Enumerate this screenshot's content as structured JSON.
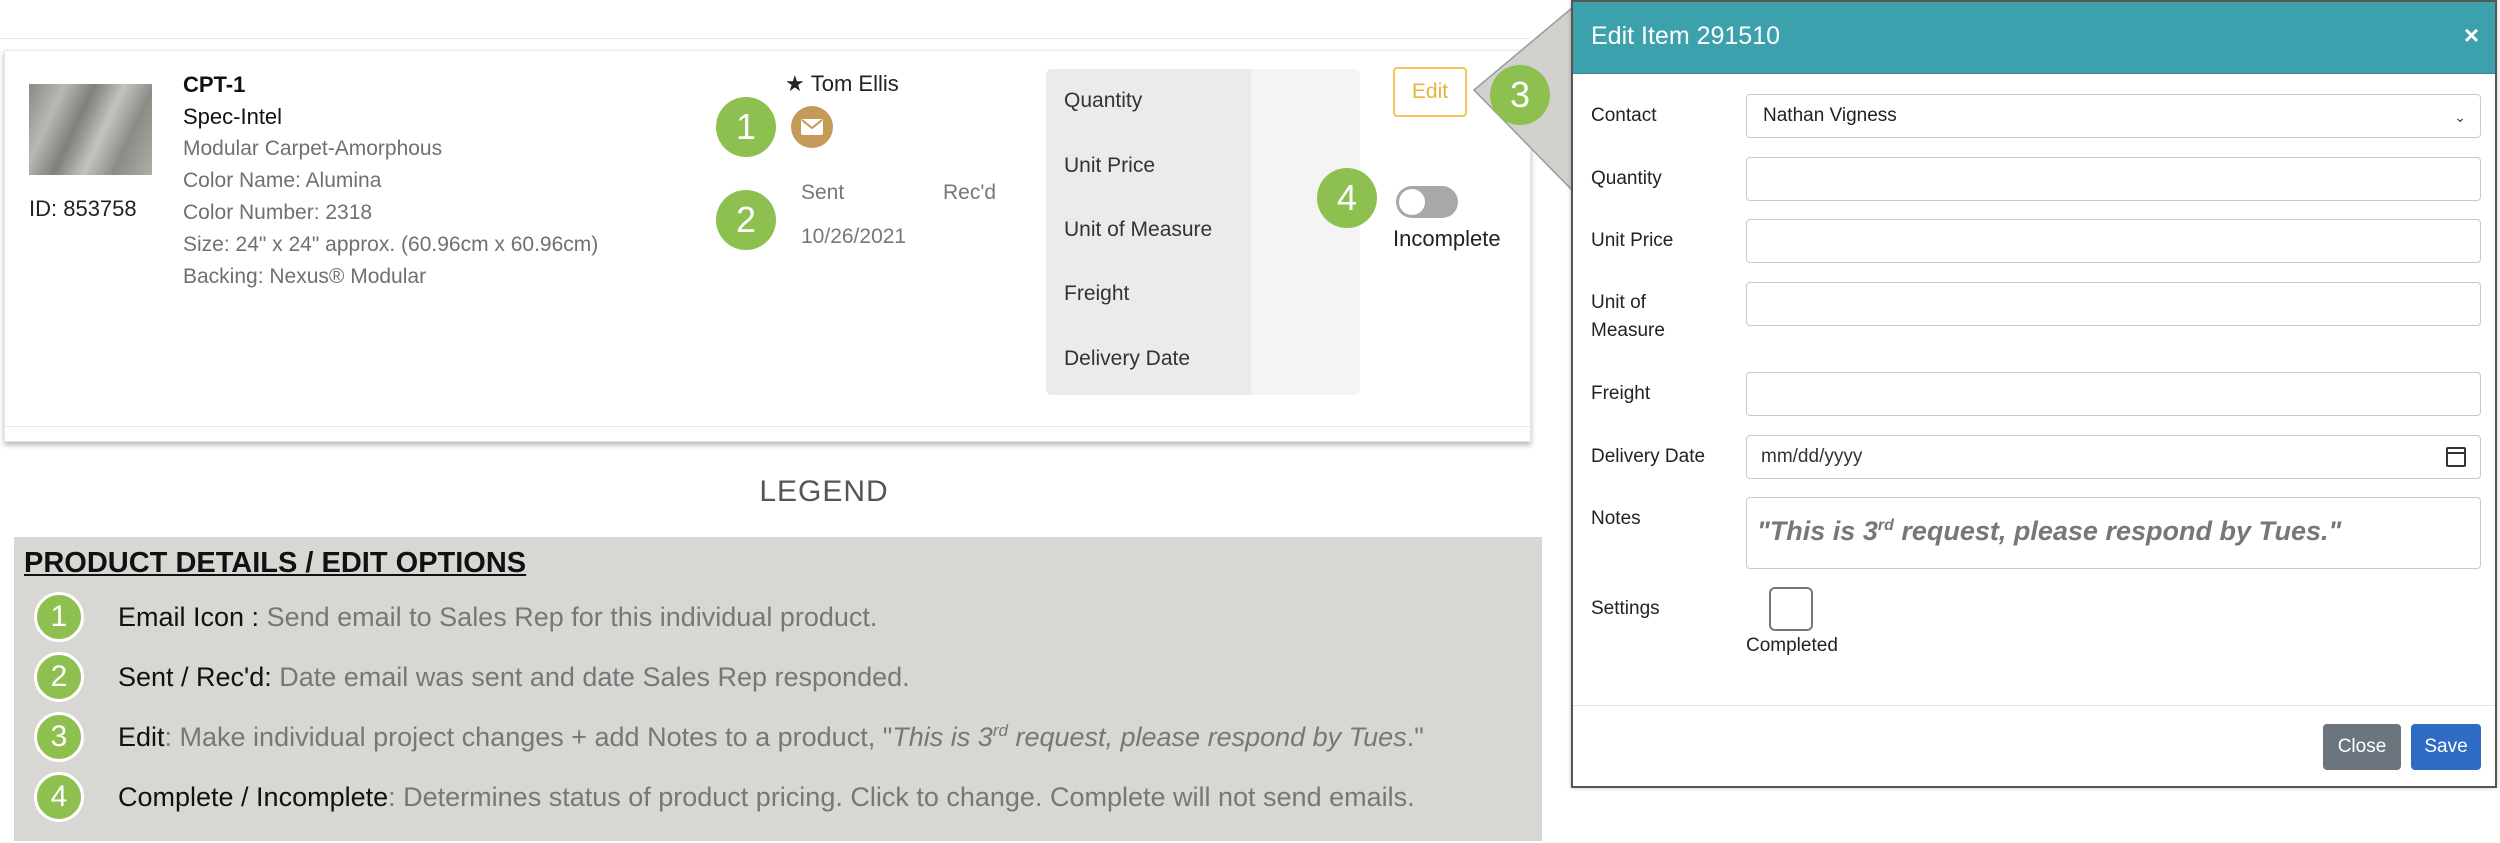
{
  "product": {
    "id_text": "ID: 853758",
    "code": "CPT-1",
    "spec": "Spec-Intel",
    "lines": [
      "Modular Carpet-Amorphous",
      "Color Name: Alumina",
      "Color Number: 2318",
      "Size: 24\" x 24\" approx. (60.96cm x 60.96cm)",
      "Backing: Nexus® Modular"
    ]
  },
  "sales_rep": {
    "star": "★",
    "name": "Tom Ellis",
    "mail_icon": "envelope-icon"
  },
  "status_dates": {
    "sent_label": "Sent",
    "recd_label": "Rec'd",
    "sent_date": "10/26/2021"
  },
  "pricing_labels": [
    "Quantity",
    "Unit Price",
    "Unit of Measure",
    "Freight",
    "Delivery Date"
  ],
  "edit_label": "Edit",
  "completion": {
    "label": "Incomplete",
    "is_complete": false
  },
  "badges": [
    "1",
    "2",
    "3",
    "4"
  ],
  "legend": {
    "title": "LEGEND",
    "heading": "PRODUCT DETAILS / EDIT OPTIONS",
    "rows": [
      {
        "num": "1",
        "term": "Email Icon :",
        "desc": " Send email to Sales Rep for this individual product."
      },
      {
        "num": "2",
        "term": "Sent / Rec'd:",
        "desc": " Date email was sent and date Sales Rep responded."
      },
      {
        "num": "3",
        "term": "Edit",
        "desc": ": Make individual project changes + add Notes to a product, \"",
        "quote_a": "This is 3",
        "sup": "rd",
        "quote_b": " request, please respond by Tues",
        "tail": ".\""
      },
      {
        "num": "4",
        "term": "Complete / Incomplete",
        "desc": ": Determines status of product pricing. Click to change. Complete will not send emails."
      }
    ]
  },
  "modal": {
    "title": "Edit Item 291510",
    "close_glyph": "×",
    "contact_label": "Contact",
    "contact_value": "Nathan Vigness",
    "quantity_label": "Quantity",
    "unit_price_label": "Unit Price",
    "uom_label_1": "Unit of",
    "uom_label_2": "Measure",
    "freight_label": "Freight",
    "delivery_label": "Delivery Date",
    "delivery_placeholder": "mm/dd/yyyy",
    "notes_label": "Notes",
    "notes_a": "\"This is 3",
    "notes_sup": "rd",
    "notes_b": " request, please respond by Tues.\"",
    "settings_label": "Settings",
    "completed_label": "Completed",
    "close_button": "Close",
    "save_button": "Save"
  },
  "colors": {
    "badge": "#8dc04e",
    "modal_header": "#3da0ad",
    "edit_border": "#f2c45a",
    "mail_icon_bg": "#c49a58",
    "save_button": "#2f6bc4",
    "close_button": "#6c757d",
    "legend_bg": "#d8d7d3"
  }
}
